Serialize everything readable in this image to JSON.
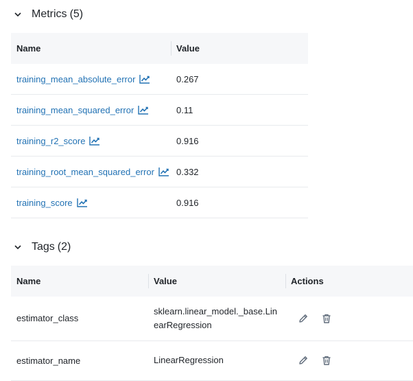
{
  "metrics": {
    "title": "Metrics",
    "count": "(5)",
    "columns": {
      "name": "Name",
      "value": "Value"
    },
    "rows": [
      {
        "name": "training_mean_absolute_error",
        "value": "0.267"
      },
      {
        "name": "training_mean_squared_error",
        "value": "0.11"
      },
      {
        "name": "training_r2_score",
        "value": "0.916"
      },
      {
        "name": "training_root_mean_squared_error",
        "value": "0.332"
      },
      {
        "name": "training_score",
        "value": "0.916"
      }
    ]
  },
  "tags": {
    "title": "Tags",
    "count": "(2)",
    "columns": {
      "name": "Name",
      "value": "Value",
      "actions": "Actions"
    },
    "rows": [
      {
        "name": "estimator_class",
        "value": "sklearn.linear_model._base.LinearRegression"
      },
      {
        "name": "estimator_name",
        "value": "LinearRegression"
      }
    ]
  },
  "icons": {
    "collapse": "chevron-down-icon",
    "metric_chart": "line-chart-icon",
    "edit": "pencil-icon",
    "delete": "trash-icon"
  },
  "colors": {
    "link": "#2272b4",
    "header_bg": "#f6f7f9",
    "border": "#e8eaed",
    "icon": "#5f6b7a"
  }
}
